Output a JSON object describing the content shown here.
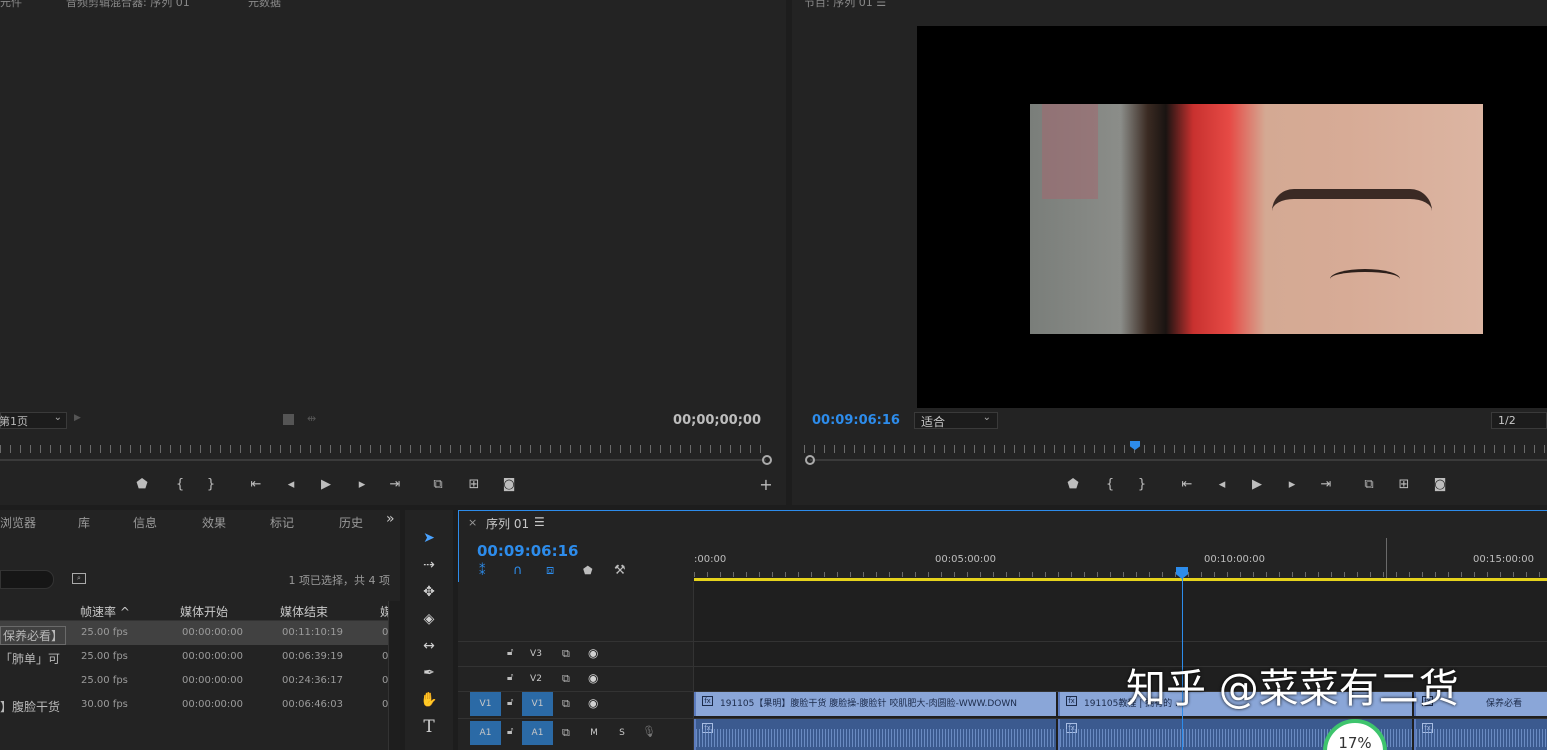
{
  "source_panel": {
    "header_left": "元件",
    "header_mid": "音频剪辑混合器: 序列 01",
    "header_right": "元数据",
    "page_select": "第1页",
    "timecode": "00;00;00;00"
  },
  "program_panel": {
    "header": "节目: 序列 01 ☰",
    "timecode": "00:09:06:16",
    "fit_select": "适合",
    "resolution_select": "1/2",
    "playhead_progress": 0.45
  },
  "project_panel": {
    "tabs": [
      "浏览器",
      "库",
      "信息",
      "效果",
      "标记",
      "历史"
    ],
    "more_label": "»",
    "selection_info": "1 项已选择，共 4 项",
    "columns": [
      "帧速率 ^",
      "媒体开始",
      "媒体结束",
      "媒"
    ],
    "rows": [
      {
        "name": "保养必看】",
        "fps": "25.00 fps",
        "start": "00:00:00:00",
        "end": "00:11:10:19",
        "extra": "0"
      },
      {
        "name": "「肺单」可",
        "fps": "25.00 fps",
        "start": "00:00:00:00",
        "end": "00:06:39:19",
        "extra": "0"
      },
      {
        "name": "",
        "fps": "25.00 fps",
        "start": "00:00:00:00",
        "end": "00:24:36:17",
        "extra": "0"
      },
      {
        "name": "】腹脸干货",
        "fps": "30.00 fps",
        "start": "00:00:00:00",
        "end": "00:06:46:03",
        "extra": "0"
      }
    ]
  },
  "timeline": {
    "tab_close": "×",
    "tab_label": "序列 01",
    "tab_menu": "☰",
    "timecode": "00:09:06:16",
    "ruler_labels": [
      ":00:00",
      "00:05:00:00",
      "00:10:00:00",
      "00:15:00:00"
    ],
    "tracks": {
      "v3": "V3",
      "v2": "V2",
      "v1_src": "V1",
      "v1": "V1",
      "a1_src": "A1",
      "a1": "A1",
      "m": "M",
      "s": "S"
    },
    "clips": [
      "191105【果明】腹脸干货 腹脸操-腹脸针 咬肌肥大-肉圆脸-WWW.DOWN",
      "191105教程 | 拥有的 ...",
      "保养必看"
    ]
  },
  "watermark": "知乎 @菜菜有二货",
  "progress_badge": "17%",
  "colors": {
    "accent_blue": "#2d8ceb",
    "playhead_yellow": "#e6d31c",
    "clip_video": "#8aa6d8",
    "clip_audio": "#3b5a8f",
    "headband_red": "#e23c3c"
  }
}
